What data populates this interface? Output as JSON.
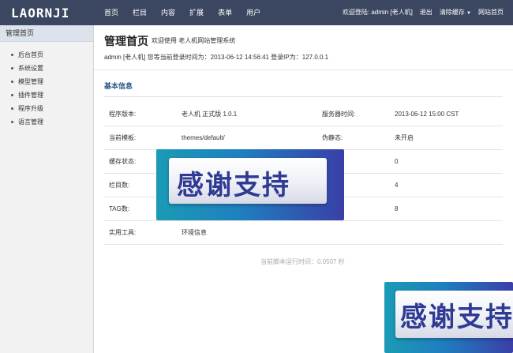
{
  "logo": "LAORNJI",
  "nav": [
    "首页",
    "栏目",
    "内容",
    "扩展",
    "表单",
    "用户"
  ],
  "top_right": {
    "welcome": "欢迎登陆: admin [老人机]",
    "logout": "退出",
    "clear_cache": "清除缓存",
    "site_home": "网站首页"
  },
  "sidebar": {
    "title": "管理首页",
    "items": [
      "后台首页",
      "系统设置",
      "模型管理",
      "插件管理",
      "程序升级",
      "语言管理"
    ]
  },
  "main": {
    "title": "管理首页",
    "subtitle": "欢迎使用 老人机网站管理系统",
    "login_info": "admin [老人机]  您等当前登录时间为：2013-06-12 14:56:41  登录IP为：127.0.0.1",
    "section_title": "基本信息",
    "rows": [
      {
        "k1": "程序版本:",
        "v1": "老人机 正式版 1.0.1",
        "k2": "服务器时间:",
        "v2": "2013-06-12 15:00 CST"
      },
      {
        "k1": "当前模板:",
        "v1": "themes/default/",
        "k2": "伪静态:",
        "v2": "未开启"
      },
      {
        "k1": "缓存状态:",
        "v1": "",
        "k2": "",
        "v2": "0"
      },
      {
        "k1": "栏目数:",
        "v1": "",
        "k2": "",
        "v2": "4"
      },
      {
        "k1": "TAG数:",
        "v1": "",
        "k2": "",
        "v2": "8"
      },
      {
        "k1": "实用工具:",
        "v1": "环境信息",
        "k2": "",
        "v2": ""
      }
    ],
    "footer_note": "当前脚本运行时间：0.0507 秒"
  },
  "overlay": {
    "badge_text": "感谢支持"
  },
  "colors": {
    "topbar": "#3b4660",
    "section_title": "#2a5a88",
    "warning": "#d9322b"
  }
}
